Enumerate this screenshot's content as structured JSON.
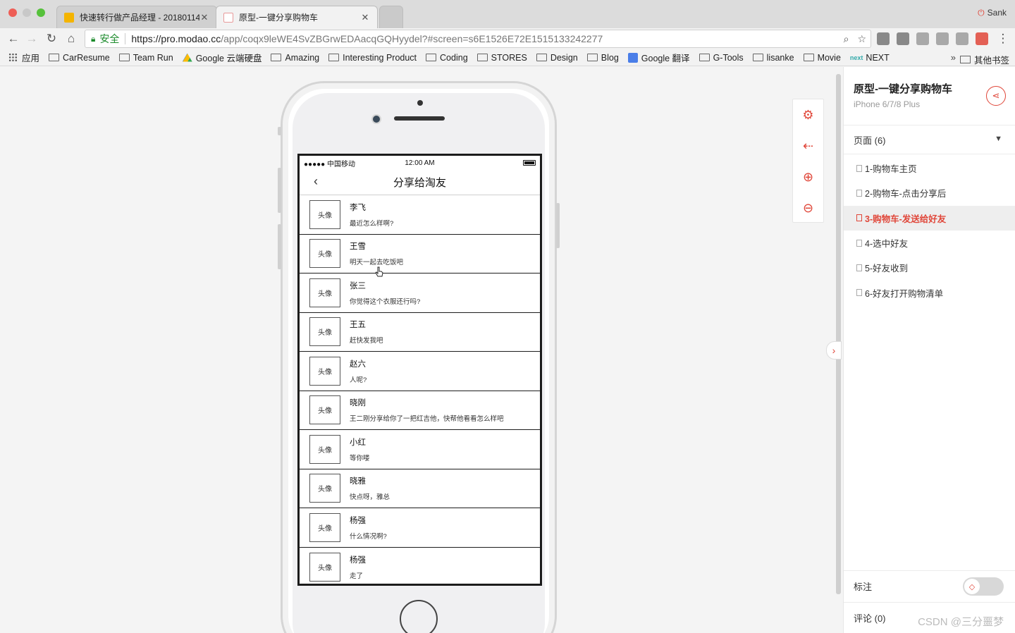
{
  "browser": {
    "tabs": [
      {
        "label": "快速转行做产品经理 - 20180114",
        "active": false
      },
      {
        "label": "原型-一键分享购物车",
        "active": true
      }
    ],
    "profile": "Sank",
    "url": {
      "secure_label": "安全",
      "host": "https://pro.modao.cc",
      "path": "/app/coqx9leWE4SvZBGrwEDAacqGQHyydel?#screen=s6E1526E72E1515133242277"
    },
    "bookmarks": [
      {
        "label": "应用",
        "icon": "grid"
      },
      {
        "label": "CarResume",
        "icon": "folder"
      },
      {
        "label": "Team Run",
        "icon": "folder"
      },
      {
        "label": "Google 云端硬盘",
        "icon": "gdrive"
      },
      {
        "label": "Amazing",
        "icon": "folder"
      },
      {
        "label": "Interesting Product",
        "icon": "folder"
      },
      {
        "label": "Coding",
        "icon": "folder"
      },
      {
        "label": "STORES",
        "icon": "folder"
      },
      {
        "label": "Design",
        "icon": "folder"
      },
      {
        "label": "Blog",
        "icon": "folder"
      },
      {
        "label": "Google 翻译",
        "icon": "gtrans"
      },
      {
        "label": "G-Tools",
        "icon": "folder"
      },
      {
        "label": "lisanke",
        "icon": "folder"
      },
      {
        "label": "Movie",
        "icon": "folder"
      },
      {
        "label": "NEXT",
        "icon": "next"
      }
    ],
    "bookmarks_more": "»",
    "bookmarks_other": "其他书签"
  },
  "phone": {
    "status": {
      "carrier": "●●●●● 中国移动",
      "time": "12:00 AM"
    },
    "nav_title": "分享给淘友",
    "avatar_label": "头像",
    "friends": [
      {
        "name": "李飞",
        "msg": "最近怎么样啊?"
      },
      {
        "name": "王雪",
        "msg": "明天一起去吃饭吧"
      },
      {
        "name": "张三",
        "msg": "你觉得这个衣服还行吗?"
      },
      {
        "name": "王五",
        "msg": "赶快发我吧"
      },
      {
        "name": "赵六",
        "msg": "人呢?"
      },
      {
        "name": "晓刚",
        "msg": "王二刚分享给你了一把红吉他，快帮他看看怎么样吧"
      },
      {
        "name": "小红",
        "msg": "等你喽"
      },
      {
        "name": "晓雅",
        "msg": "快点呀，雅总"
      },
      {
        "name": "杨强",
        "msg": "什么情况啊?"
      },
      {
        "name": "杨强",
        "msg": "走了"
      }
    ]
  },
  "panel": {
    "title": "原型-一键分享购物车",
    "device": "iPhone 6/7/8 Plus",
    "pages_label": "页面 (6)",
    "pages": [
      {
        "label": "1-购物车主页",
        "active": false
      },
      {
        "label": "2-购物车-点击分享后",
        "active": false
      },
      {
        "label": "3-购物车-发送给好友",
        "active": true
      },
      {
        "label": "4-选中好友",
        "active": false
      },
      {
        "label": "5-好友收到",
        "active": false
      },
      {
        "label": "6-好友打开购物清单",
        "active": false
      }
    ],
    "annotation_label": "标注",
    "comments_label": "评论 (0)",
    "watermark": "CSDN @三分噩梦"
  },
  "colors": {
    "accent": "#e0473a",
    "secure": "#1a8a2a"
  }
}
